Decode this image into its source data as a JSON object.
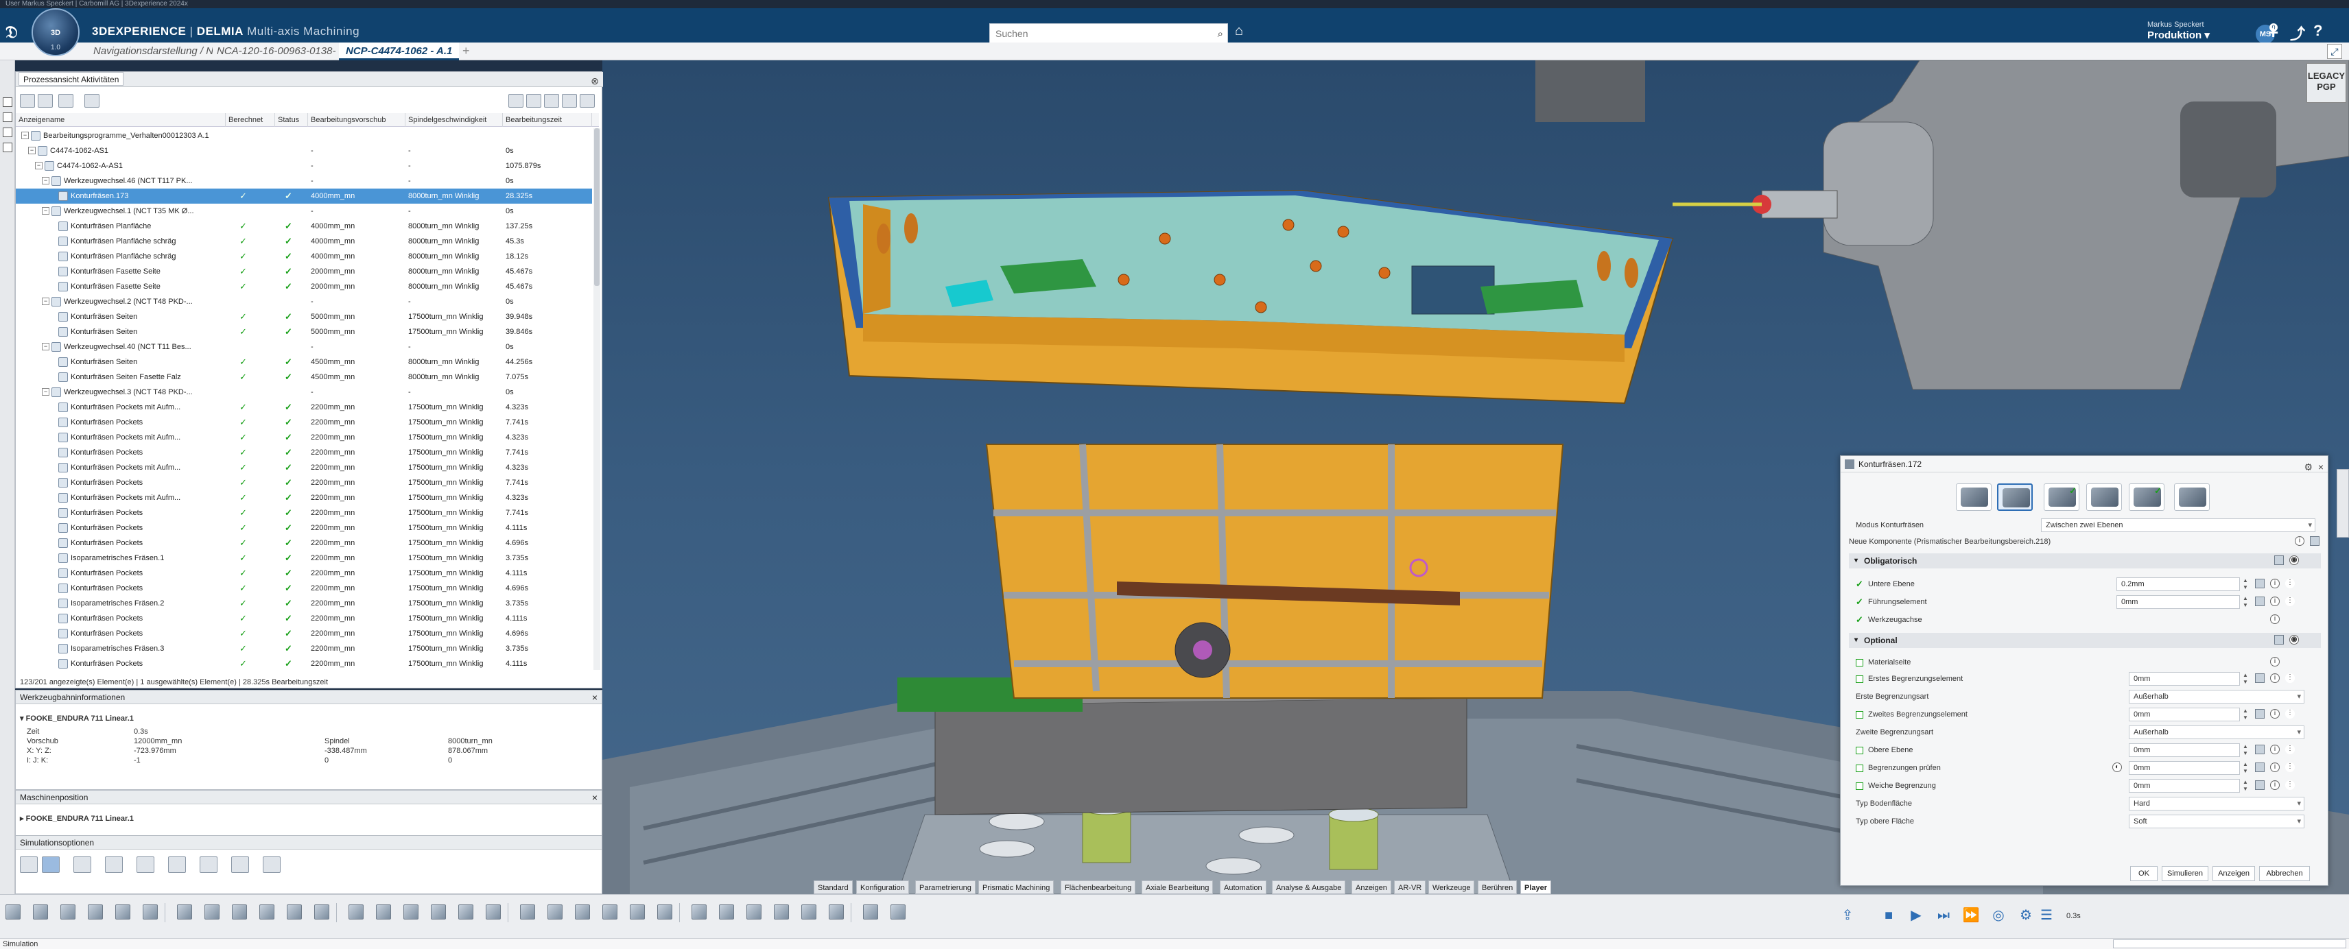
{
  "window": {
    "os_title": "User Markus Speckert | Carbomill AG | 3Dexperience 2024x"
  },
  "compass": {
    "label": "3D",
    "version": "1.0"
  },
  "header": {
    "brand_bold": "3DEXPERIENCE",
    "brand_sep": " | ",
    "brand_app": "DELMIA",
    "brand_module": " Multi-axis Machining",
    "search_placeholder": "Suchen",
    "user_name": "Markus Speckert",
    "user_role": "Produktion",
    "avatar_initials": "MS",
    "avatar_badge": "0"
  },
  "tabs": [
    {
      "label": "Navigationsdarstellung / N"
    },
    {
      "label": "NCA-120-16-00963-0138-"
    },
    {
      "label": "NCP-C4474-1062 - A.1",
      "active": true
    }
  ],
  "process_panel": {
    "title": "Prozessansicht Aktivitäten",
    "columns": [
      "Anzeigename",
      "Berechnet",
      "Status",
      "Bearbeitungsvorschub",
      "Spindelgeschwindigkeit",
      "Bearbeitungszeit"
    ],
    "rows": [
      {
        "indent": 0,
        "name": "Bearbeitungsprogramme_Verhalten00012303 A.1",
        "b": "",
        "s": "",
        "feed": "",
        "spindle": "",
        "time": ""
      },
      {
        "indent": 1,
        "name": "C4474-1062-AS1",
        "b": "",
        "s": "",
        "feed": "-",
        "spindle": "-",
        "time": "0s"
      },
      {
        "indent": 2,
        "name": "C4474-1062-A-AS1",
        "b": "",
        "s": "",
        "feed": "-",
        "spindle": "-",
        "time": "1075.879s"
      },
      {
        "indent": 3,
        "name": "Werkzeugwechsel.46 (NCT T117 PK...",
        "b": "",
        "s": "",
        "feed": "-",
        "spindle": "-",
        "time": "0s"
      },
      {
        "indent": 4,
        "name": "Konturfräsen.173",
        "b": "✓",
        "s": "✓",
        "feed": "4000mm_mn",
        "spindle": "8000turn_mn Winklig",
        "time": "28.325s",
        "selected": true
      },
      {
        "indent": 3,
        "name": "Werkzeugwechsel.1 (NCT T35 MK Ø...",
        "b": "",
        "s": "",
        "feed": "-",
        "spindle": "-",
        "time": "0s"
      },
      {
        "indent": 4,
        "name": "Konturfräsen Planfläche",
        "b": "✓",
        "s": "✓",
        "feed": "4000mm_mn",
        "spindle": "8000turn_mn Winklig",
        "time": "137.25s"
      },
      {
        "indent": 4,
        "name": "Konturfräsen Planfläche schräg",
        "b": "✓",
        "s": "✓",
        "feed": "4000mm_mn",
        "spindle": "8000turn_mn Winklig",
        "time": "45.3s"
      },
      {
        "indent": 4,
        "name": "Konturfräsen Planfläche schräg",
        "b": "✓",
        "s": "✓",
        "feed": "4000mm_mn",
        "spindle": "8000turn_mn Winklig",
        "time": "18.12s"
      },
      {
        "indent": 4,
        "name": "Konturfräsen Fasette Seite",
        "b": "✓",
        "s": "✓",
        "feed": "2000mm_mn",
        "spindle": "8000turn_mn Winklig",
        "time": "45.467s"
      },
      {
        "indent": 4,
        "name": "Konturfräsen Fasette Seite",
        "b": "✓",
        "s": "✓",
        "feed": "2000mm_mn",
        "spindle": "8000turn_mn Winklig",
        "time": "45.467s"
      },
      {
        "indent": 3,
        "name": "Werkzeugwechsel.2 (NCT T48 PKD-...",
        "b": "",
        "s": "",
        "feed": "-",
        "spindle": "-",
        "time": "0s"
      },
      {
        "indent": 4,
        "name": "Konturfräsen Seiten",
        "b": "✓",
        "s": "✓",
        "feed": "5000mm_mn",
        "spindle": "17500turn_mn Winklig",
        "time": "39.948s"
      },
      {
        "indent": 4,
        "name": "Konturfräsen Seiten",
        "b": "✓",
        "s": "✓",
        "feed": "5000mm_mn",
        "spindle": "17500turn_mn Winklig",
        "time": "39.846s"
      },
      {
        "indent": 3,
        "name": "Werkzeugwechsel.40 (NCT T11 Bes...",
        "b": "",
        "s": "",
        "feed": "-",
        "spindle": "-",
        "time": "0s"
      },
      {
        "indent": 4,
        "name": "Konturfräsen Seiten",
        "b": "✓",
        "s": "✓",
        "feed": "4500mm_mn",
        "spindle": "8000turn_mn Winklig",
        "time": "44.256s"
      },
      {
        "indent": 4,
        "name": "Konturfräsen Seiten Fasette Falz",
        "b": "✓",
        "s": "✓",
        "feed": "4500mm_mn",
        "spindle": "8000turn_mn Winklig",
        "time": "7.075s"
      },
      {
        "indent": 3,
        "name": "Werkzeugwechsel.3 (NCT T48 PKD-...",
        "b": "",
        "s": "",
        "feed": "-",
        "spindle": "-",
        "time": "0s"
      },
      {
        "indent": 4,
        "name": "Konturfräsen Pockets mit Aufm...",
        "b": "✓",
        "s": "✓",
        "feed": "2200mm_mn",
        "spindle": "17500turn_mn Winklig",
        "time": "4.323s"
      },
      {
        "indent": 4,
        "name": "Konturfräsen Pockets",
        "b": "✓",
        "s": "✓",
        "feed": "2200mm_mn",
        "spindle": "17500turn_mn Winklig",
        "time": "7.741s"
      },
      {
        "indent": 4,
        "name": "Konturfräsen Pockets mit Aufm...",
        "b": "✓",
        "s": "✓",
        "feed": "2200mm_mn",
        "spindle": "17500turn_mn Winklig",
        "time": "4.323s"
      },
      {
        "indent": 4,
        "name": "Konturfräsen Pockets",
        "b": "✓",
        "s": "✓",
        "feed": "2200mm_mn",
        "spindle": "17500turn_mn Winklig",
        "time": "7.741s"
      },
      {
        "indent": 4,
        "name": "Konturfräsen Pockets mit Aufm...",
        "b": "✓",
        "s": "✓",
        "feed": "2200mm_mn",
        "spindle": "17500turn_mn Winklig",
        "time": "4.323s"
      },
      {
        "indent": 4,
        "name": "Konturfräsen Pockets",
        "b": "✓",
        "s": "✓",
        "feed": "2200mm_mn",
        "spindle": "17500turn_mn Winklig",
        "time": "7.741s"
      },
      {
        "indent": 4,
        "name": "Konturfräsen Pockets mit Aufm...",
        "b": "✓",
        "s": "✓",
        "feed": "2200mm_mn",
        "spindle": "17500turn_mn Winklig",
        "time": "4.323s"
      },
      {
        "indent": 4,
        "name": "Konturfräsen Pockets",
        "b": "✓",
        "s": "✓",
        "feed": "2200mm_mn",
        "spindle": "17500turn_mn Winklig",
        "time": "7.741s"
      },
      {
        "indent": 4,
        "name": "Konturfräsen Pockets",
        "b": "✓",
        "s": "✓",
        "feed": "2200mm_mn",
        "spindle": "17500turn_mn Winklig",
        "time": "4.111s"
      },
      {
        "indent": 4,
        "name": "Konturfräsen Pockets",
        "b": "✓",
        "s": "✓",
        "feed": "2200mm_mn",
        "spindle": "17500turn_mn Winklig",
        "time": "4.696s"
      },
      {
        "indent": 4,
        "name": "Isoparametrisches Fräsen.1",
        "b": "✓",
        "s": "✓",
        "feed": "2200mm_mn",
        "spindle": "17500turn_mn Winklig",
        "time": "3.735s"
      },
      {
        "indent": 4,
        "name": "Konturfräsen Pockets",
        "b": "✓",
        "s": "✓",
        "feed": "2200mm_mn",
        "spindle": "17500turn_mn Winklig",
        "time": "4.111s"
      },
      {
        "indent": 4,
        "name": "Konturfräsen Pockets",
        "b": "✓",
        "s": "✓",
        "feed": "2200mm_mn",
        "spindle": "17500turn_mn Winklig",
        "time": "4.696s"
      },
      {
        "indent": 4,
        "name": "Isoparametrisches Fräsen.2",
        "b": "✓",
        "s": "✓",
        "feed": "2200mm_mn",
        "spindle": "17500turn_mn Winklig",
        "time": "3.735s"
      },
      {
        "indent": 4,
        "name": "Konturfräsen Pockets",
        "b": "✓",
        "s": "✓",
        "feed": "2200mm_mn",
        "spindle": "17500turn_mn Winklig",
        "time": "4.111s"
      },
      {
        "indent": 4,
        "name": "Konturfräsen Pockets",
        "b": "✓",
        "s": "✓",
        "feed": "2200mm_mn",
        "spindle": "17500turn_mn Winklig",
        "time": "4.696s"
      },
      {
        "indent": 4,
        "name": "Isoparametrisches Fräsen.3",
        "b": "✓",
        "s": "✓",
        "feed": "2200mm_mn",
        "spindle": "17500turn_mn Winklig",
        "time": "3.735s"
      },
      {
        "indent": 4,
        "name": "Konturfräsen Pockets",
        "b": "✓",
        "s": "✓",
        "feed": "2200mm_mn",
        "spindle": "17500turn_mn Winklig",
        "time": "4.111s"
      }
    ],
    "status": "123/201 angezeigte(s) Element(e) | 1 ausgewählte(s) Element(e) | 28.325s Bearbeitungszeit"
  },
  "tool_info": {
    "title": "Werkzeugbahninformationen",
    "machine": "FOOKE_ENDURA 711 Linear.1",
    "zeit_label": "Zeit",
    "zeit_value": "0.3s",
    "vorschub_label": "Vorschub",
    "vorschub_value": "12000mm_mn",
    "xyz_label": "X: Y: Z:",
    "xyz_value": "-723.976mm",
    "ijk_label": "I: J: K:",
    "ijk_value": "-1",
    "spindel_label": "Spindel",
    "spindel_value": "8000turn_mn",
    "y_value": "-338.487mm",
    "z_value": "878.067mm",
    "j_value": "0",
    "k_value": "0"
  },
  "machine_pos": {
    "title": "Maschinenposition",
    "machine": "FOOKE_ENDURA 711 Linear.1"
  },
  "sim_options": {
    "title": "Simulationsoptionen"
  },
  "dialog": {
    "title": "Konturfräsen.172",
    "mode_label": "Modus Konturfräsen",
    "mode_value": "Zwischen zwei Ebenen",
    "new_component": "Neue Komponente (Prismatischer Bearbeitungsbereich.218)",
    "sec_obligatory": "Obligatorisch",
    "untere_ebene_label": "Untere Ebene",
    "untere_ebene_value": "0.2mm",
    "fuehrung_label": "Führungselement",
    "fuehrung_value": "0mm",
    "werkzeugachse_label": "Werkzeugachse",
    "sec_optional": "Optional",
    "materialseite_label": "Materialseite",
    "erstes_label": "Erstes Begrenzungselement",
    "erstes_value": "0mm",
    "erste_art_label": "Erste Begrenzungsart",
    "erste_art_value": "Außerhalb",
    "zweites_label": "Zweites Begrenzungselement",
    "zweites_value": "0mm",
    "zweite_art_label": "Zweite Begrenzungsart",
    "zweite_art_value": "Außerhalb",
    "obere_label": "Obere Ebene",
    "obere_value": "0mm",
    "pruefen_label": "Begrenzungen prüfen",
    "pruefen_value": "0mm",
    "weiche_label": "Weiche Begrenzung",
    "weiche_value": "0mm",
    "typ_boden_label": "Typ Bodenfläche",
    "typ_boden_value": "Hard",
    "typ_obere_label": "Typ obere Fläche",
    "typ_obere_value": "Soft",
    "btn_ok": "OK",
    "btn_sim": "Simulieren",
    "btn_show": "Anzeigen",
    "btn_cancel": "Abbrechen"
  },
  "workbench_tabs": [
    "Standard",
    "Konfiguration",
    "Parametrierung",
    "Prismatic Machining",
    "Flächenbearbeitung",
    "Axiale Bearbeitung",
    "Automation",
    "Analyse & Ausgabe",
    "Anzeigen",
    "AR-VR",
    "Werkzeuge",
    "Berühren",
    "Player"
  ],
  "player": {
    "time": "0.3s"
  },
  "legacy_badge": "LEGACY PGP",
  "status_bar": "Simulation",
  "colors": {
    "topbar": "#10426e",
    "selection": "#4a95d6",
    "part_orange": "#e5a531",
    "part_teal": "#8cc8c0",
    "check_green": "#19a019"
  }
}
